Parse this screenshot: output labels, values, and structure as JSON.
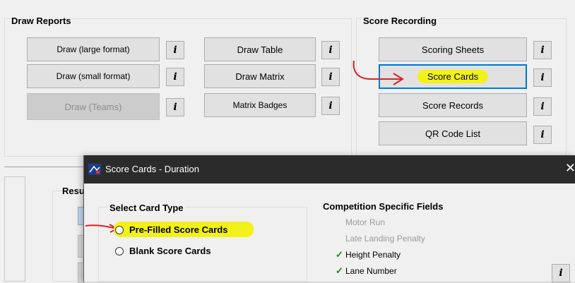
{
  "draw_reports": {
    "title": "Draw Reports",
    "buttons": {
      "draw_large": "Draw (large format)",
      "draw_small": "Draw (small format)",
      "draw_teams": "Draw (Teams)",
      "draw_table": "Draw Table",
      "draw_matrix": "Draw Matrix",
      "matrix_badges": "Matrix Badges"
    },
    "info_label": "i"
  },
  "score_recording": {
    "title": "Score Recording",
    "buttons": {
      "scoring_sheets": "Scoring Sheets",
      "score_cards": "Score Cards",
      "score_records": "Score Records",
      "qr_code_list": "QR Code List"
    }
  },
  "results": {
    "title_partial": "Resu"
  },
  "dialog": {
    "title": "Score Cards - Duration",
    "close": "✕",
    "select_card_type": {
      "title": "Select Card Type",
      "options": [
        "Pre-Filled Score Cards",
        "Blank Score Cards"
      ]
    },
    "competition_fields": {
      "title": "Competition Specific Fields",
      "fields": [
        {
          "label": "Motor Run",
          "enabled": false,
          "checked": false
        },
        {
          "label": "Late Landing Penalty",
          "enabled": false,
          "checked": false
        },
        {
          "label": "Height Penalty",
          "enabled": true,
          "checked": true
        },
        {
          "label": "Lane Number",
          "enabled": true,
          "checked": true
        }
      ],
      "check_mark": "✓"
    }
  },
  "colors": {
    "highlight": "#f2f21a",
    "focus_border": "#0078d7",
    "annotation_arrow": "#e02020",
    "check": "#1a8a1a"
  }
}
